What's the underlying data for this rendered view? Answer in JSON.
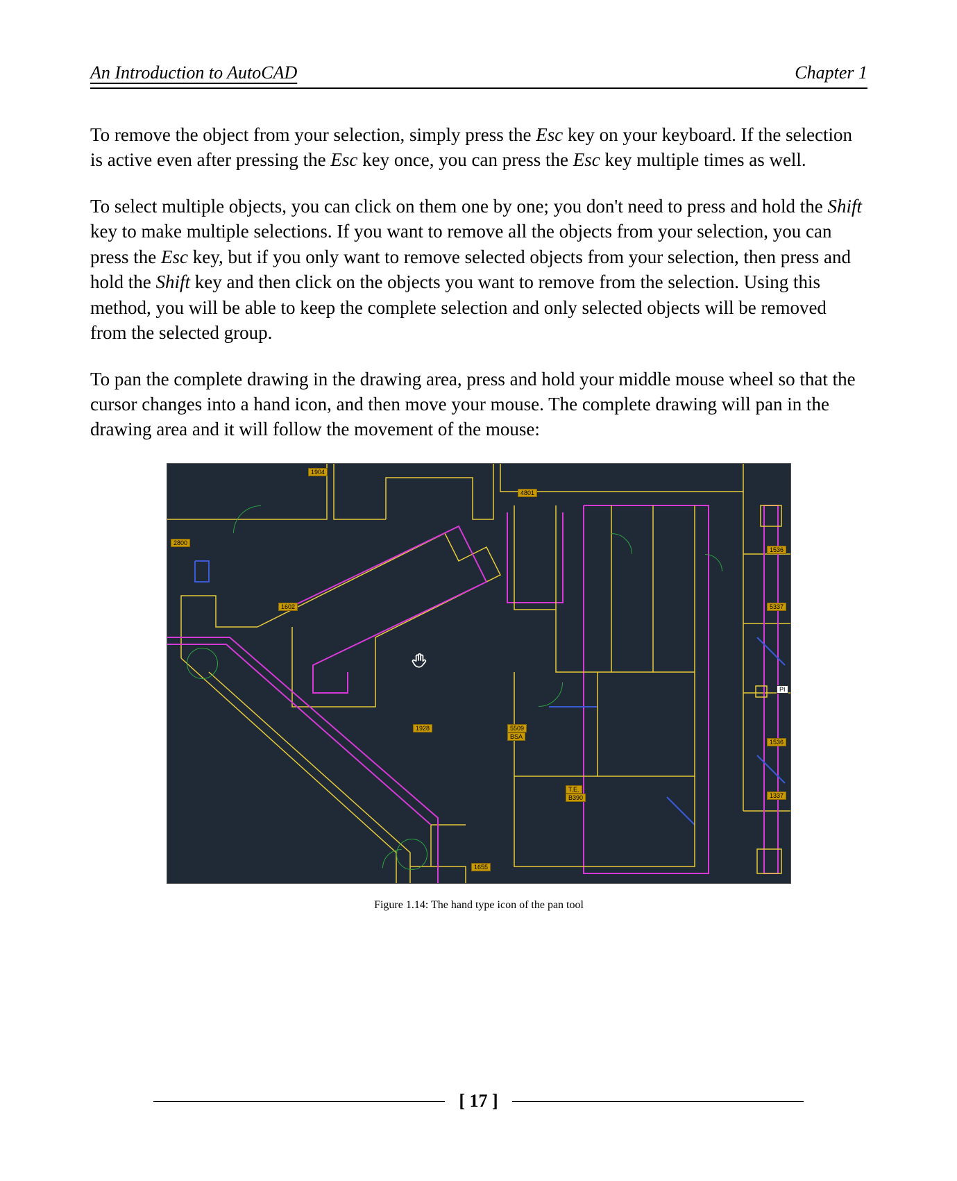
{
  "header": {
    "left": "An Introduction to AutoCAD",
    "right": "Chapter 1"
  },
  "paragraphs": {
    "p1_a": "To remove the object from your selection, simply press the ",
    "p1_b": "Esc",
    "p1_c": " key on your keyboard. If the selection is active even after pressing the ",
    "p1_d": "Esc",
    "p1_e": " key once, you can press the ",
    "p1_f": "Esc",
    "p1_g": " key multiple times as well.",
    "p2_a": "To select multiple objects, you can click on them one by one; you don't need to press and hold the ",
    "p2_b": "Shift",
    "p2_c": " key to make multiple selections. If you want to remove all the objects from your selection, you can press the ",
    "p2_d": "Esc",
    "p2_e": " key, but if you only want to remove selected objects from your selection, then press and hold the ",
    "p2_f": "Shift",
    "p2_g": " key and then click on the objects you want to remove from the selection. Using this method, you will be able to keep the complete selection and only selected objects will be removed from the selected group.",
    "p3": "To pan the complete drawing in the drawing area, press and hold your middle mouse wheel so that the cursor changes into a hand icon, and then move your mouse. The complete drawing will pan in the drawing area and it will follow the movement of the mouse:"
  },
  "figure": {
    "caption": "Figure 1.14: The hand type icon of the pan tool",
    "labels": {
      "l1": "1904",
      "l2": "2800",
      "l3": "4801",
      "l4": "1536",
      "l5": "5337",
      "l6": "1602",
      "l7": "PI",
      "l8": "1928",
      "l9": "5509",
      "l10": "1536",
      "l11": "BSA",
      "l12": "T.E.",
      "l13": "B390",
      "l14": "1337",
      "l15": "1655"
    },
    "cursor_glyph": "✊"
  },
  "page_number": "[ 17 ]"
}
